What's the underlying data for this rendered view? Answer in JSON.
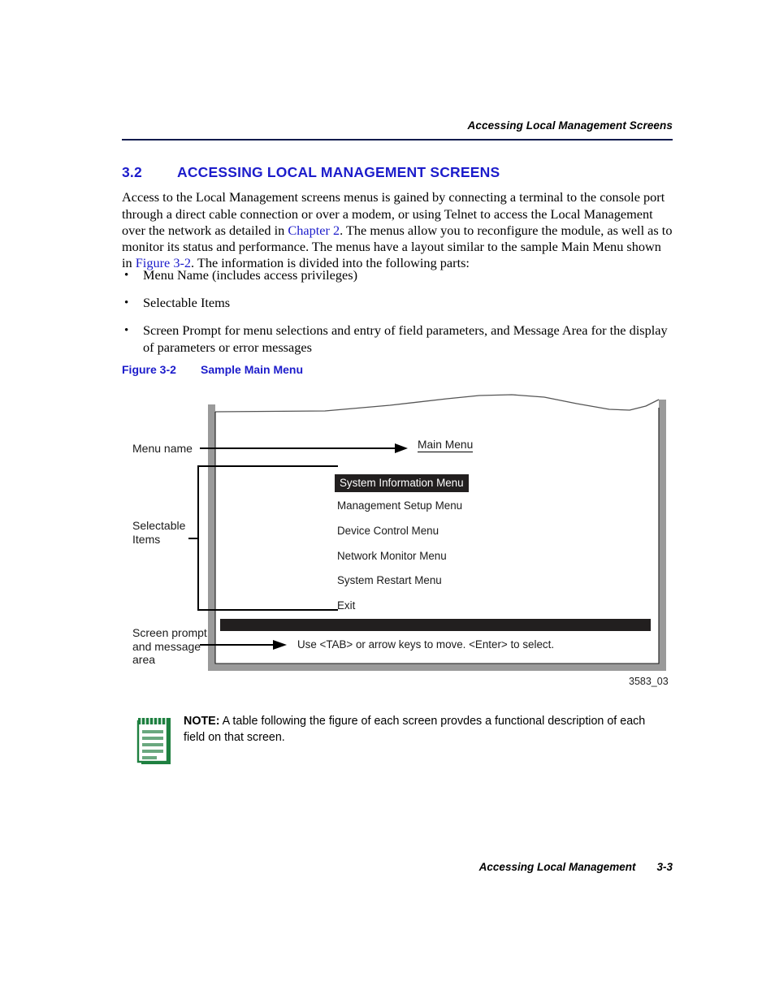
{
  "page": {
    "running_header": "Accessing Local Management Screens",
    "footer_title": "Accessing Local Management",
    "footer_page": "3-3"
  },
  "section": {
    "number": "3.2",
    "title": "ACCESSING LOCAL MANAGEMENT SCREENS",
    "paragraph": {
      "part1": "Access to the Local Management screens menus is gained by connecting a terminal to the console port through a direct cable connection or over a modem, or using Telnet to access the Local Management over the network as detailed in ",
      "xref1": "Chapter 2",
      "part2": ". The menus allow you to reconfigure the module, as well as to monitor its status and performance. The menus have a layout similar to the sample Main Menu shown in ",
      "xref2": "Figure 3-2",
      "part3": ". The information is divided into the following parts:"
    },
    "bullets": [
      "Menu Name (includes access privileges)",
      "Selectable Items",
      "Screen Prompt for menu selections and entry of field parameters, and Message Area for the display of parameters or error messages"
    ]
  },
  "figure": {
    "label": "Figure 3-2",
    "title": "Sample Main Menu",
    "id": "3583_03",
    "callouts": {
      "menu_name": "Menu name",
      "selectable_items_line1": "Selectable",
      "selectable_items_line2": "Items",
      "screen_prompt_line1": "Screen prompt",
      "screen_prompt_line2": "and message",
      "screen_prompt_line3": "area"
    },
    "screen": {
      "menu_title": "Main Menu",
      "menu_items": [
        "System Information Menu",
        "Management Setup Menu",
        "Device Control Menu",
        "Network Monitor Menu",
        "System Restart Menu",
        "Exit"
      ],
      "selected_index": 0,
      "prompt": "Use <TAB> or arrow keys to move. <Enter> to select."
    }
  },
  "note": {
    "keyword": "NOTE:",
    "body": "A table following the figure of each screen provdes a functional description of each field on that screen."
  },
  "colors": {
    "heading_blue": "#1c1ccb",
    "xref_blue": "#1c1ccb",
    "rule_navy": "#0d1a4d",
    "frame_gray": "#9a9a9a",
    "highlight_black": "#221f1f",
    "note_green": "#1e8040"
  }
}
